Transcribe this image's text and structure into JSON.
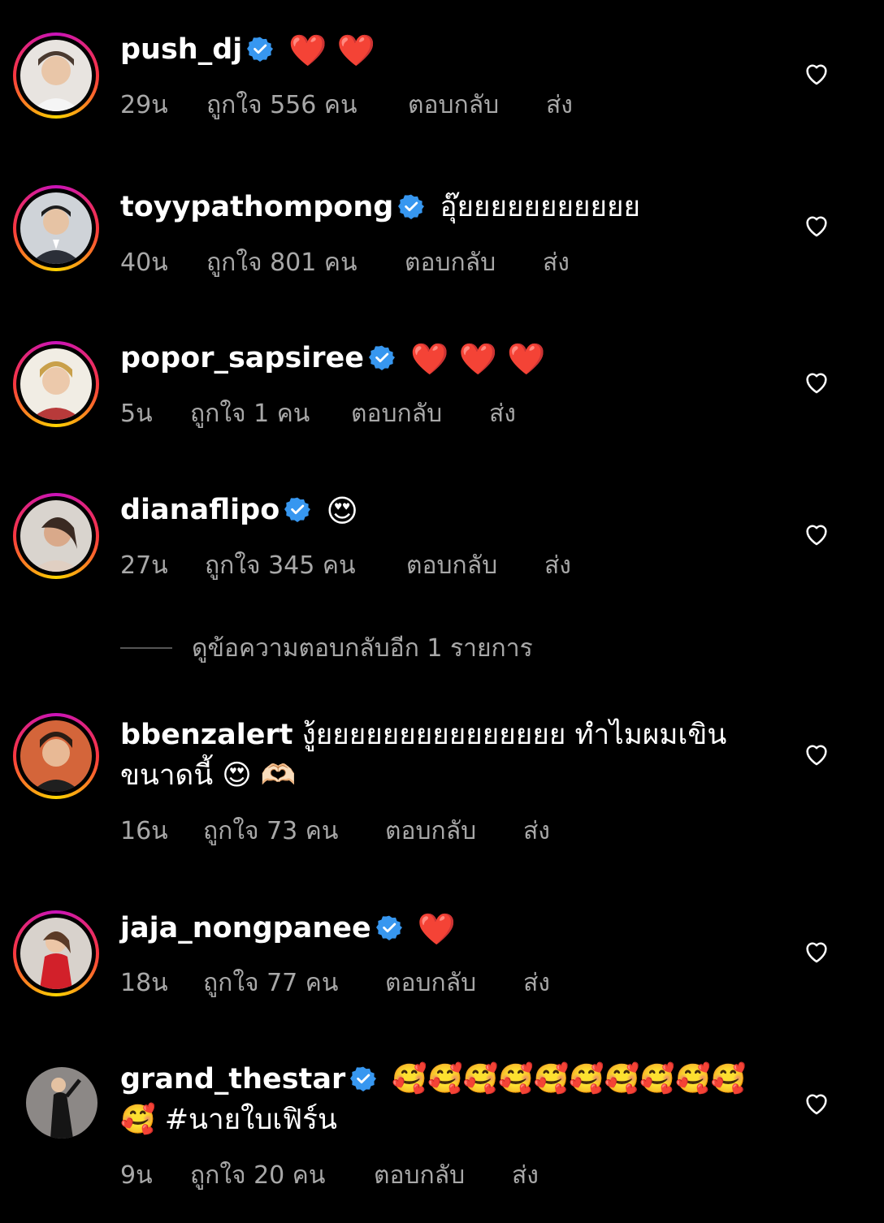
{
  "colors": {
    "background": "#000000",
    "text": "#ffffff",
    "muted": "#a8a8a8",
    "verified": "#3797f0"
  },
  "actions": {
    "reply": "ตอบกลับ",
    "send": "ส่ง"
  },
  "comments": [
    {
      "username": "push_dj",
      "verified": true,
      "text": "❤️ ❤️",
      "time": "29น",
      "likes": "ถูกใจ 556 คน"
    },
    {
      "username": "toyypathompong",
      "verified": true,
      "text": "อุ๊ยยยยยยยยยยย",
      "time": "40น",
      "likes": "ถูกใจ 801 คน"
    },
    {
      "username": "popor_sapsiree",
      "verified": true,
      "text": "❤️ ❤️ ❤️",
      "time": "5น",
      "likes": "ถูกใจ 1 คน"
    },
    {
      "username": "dianaflipo",
      "verified": true,
      "text": "😍",
      "time": "27น",
      "likes": "ถูกใจ 345 คน"
    },
    {
      "username": "bbenzalert",
      "verified": false,
      "text": "งู้ยยยยยยยยยยยยยยย ทำไมผมเขินขนาดนี้ 😍 🫶🏻",
      "time": "16น",
      "likes": "ถูกใจ 73 คน"
    },
    {
      "username": "jaja_nongpanee",
      "verified": true,
      "text": "❤️",
      "time": "18น",
      "likes": "ถูกใจ 77 คน"
    },
    {
      "username": "grand_thestar",
      "verified": true,
      "text": "🥰🥰🥰🥰🥰🥰🥰🥰🥰🥰🥰 #นายใบเฟิร์น",
      "time": "9น",
      "likes": "ถูกใจ 20 คน"
    }
  ],
  "view_replies": "ดูข้อความตอบกลับอีก 1 รายการ"
}
